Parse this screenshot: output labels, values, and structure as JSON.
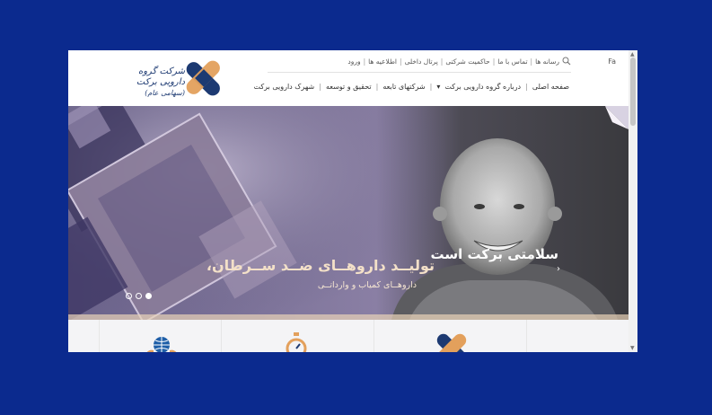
{
  "header": {
    "logo": {
      "name": "شرکت گروه دارویی برکت",
      "subtitle": "(سهامی عام)"
    },
    "topbar": {
      "lang": "Fa",
      "items": [
        "رسانه ها",
        "تماس با ما",
        "حاکمیت شرکتی",
        "پرتال داخلی",
        "اطلاعیه ها",
        "ورود"
      ]
    },
    "nav": {
      "items": [
        "صفحه اصلی",
        "درباره گروه دارویی برکت",
        "شرکتهای تابعه",
        "تحقیق و توسعه",
        "شهرک دارویی برکت"
      ]
    }
  },
  "slider": {
    "title": "تولیــد داروهــای ضــد ســرطان،",
    "subtitle": "داروهــای کمیاب و وارداتــی",
    "tagline": "سلامتی برکت است",
    "slide_count": 3,
    "active_slide": 3
  },
  "colors": {
    "page_background": "#0b2a8e",
    "brand_blue": "#1d3a72",
    "brand_orange": "#e3a05c"
  }
}
